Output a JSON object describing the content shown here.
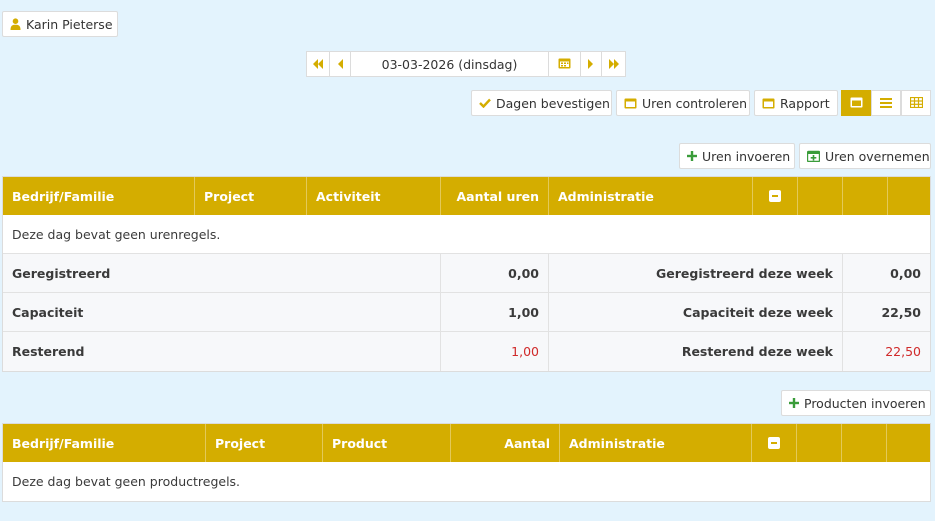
{
  "user": {
    "name": "Karin Pieterse"
  },
  "date_nav": {
    "date": "03-03-2026 (dinsdag)"
  },
  "toolbar": {
    "confirm_days": "Dagen bevestigen",
    "check_hours": "Uren controleren",
    "report": "Rapport"
  },
  "hours_section": {
    "enter_hours": "Uren invoeren",
    "copy_hours": "Uren overnemen",
    "columns": [
      "Bedrijf/Familie",
      "Project",
      "Activiteit",
      "Aantal uren",
      "Administratie"
    ],
    "empty_message": "Deze dag bevat geen urenregels.",
    "summary": [
      {
        "label": "Geregistreerd",
        "value": "0,00",
        "week_label": "Geregistreerd deze week",
        "week_value": "0,00"
      },
      {
        "label": "Capaciteit",
        "value": "1,00",
        "week_label": "Capaciteit deze week",
        "week_value": "22,50"
      },
      {
        "label": "Resterend",
        "value": "1,00",
        "week_label": "Resterend deze week",
        "week_value": "22,50"
      }
    ]
  },
  "products_section": {
    "enter_products": "Producten invoeren",
    "columns": [
      "Bedrijf/Familie",
      "Project",
      "Product",
      "Aantal",
      "Administratie"
    ],
    "empty_message": "Deze dag bevat geen productregels."
  },
  "colors": {
    "accent": "#d4ad00",
    "background": "#e3f3fd",
    "negative": "#d02a2a",
    "add": "#3a9c3a"
  }
}
